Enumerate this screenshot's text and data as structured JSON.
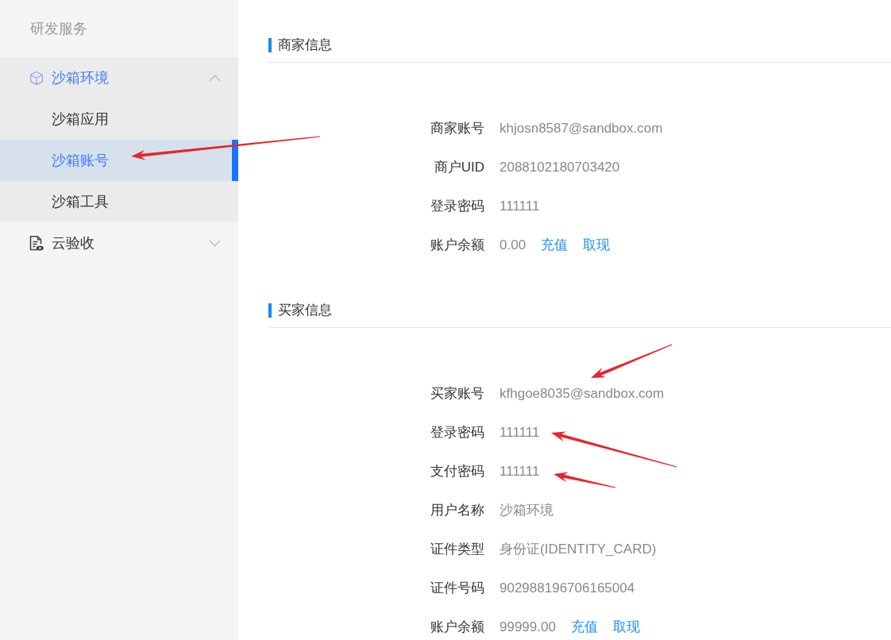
{
  "sidebar": {
    "heading": "研发服务",
    "items": [
      {
        "label": "沙箱环境",
        "active": true,
        "expanded": true,
        "children": [
          {
            "label": "沙箱应用",
            "selected": false
          },
          {
            "label": "沙箱账号",
            "selected": true
          },
          {
            "label": "沙箱工具",
            "selected": false
          }
        ]
      },
      {
        "label": "云验收",
        "active": false,
        "expanded": false
      }
    ]
  },
  "sections": [
    {
      "title": "商家信息",
      "fields": [
        {
          "label": "商家账号",
          "value": "khjosn8587@sandbox.com"
        },
        {
          "label": "商户UID",
          "value": "2088102180703420"
        },
        {
          "label": "登录密码",
          "value": "111111"
        },
        {
          "label": "账户余额",
          "value": "0.00",
          "links": [
            "充值",
            "取现"
          ]
        }
      ]
    },
    {
      "title": "买家信息",
      "fields": [
        {
          "label": "买家账号",
          "value": "kfhgoe8035@sandbox.com"
        },
        {
          "label": "登录密码",
          "value": "111111"
        },
        {
          "label": "支付密码",
          "value": "111111"
        },
        {
          "label": "用户名称",
          "value": "沙箱环境"
        },
        {
          "label": "证件类型",
          "value": "身份证(IDENTITY_CARD)"
        },
        {
          "label": "证件号码",
          "value": "902988196706165004"
        },
        {
          "label": "账户余额",
          "value": "99999.00",
          "links": [
            "充值",
            "取现"
          ]
        }
      ]
    }
  ]
}
